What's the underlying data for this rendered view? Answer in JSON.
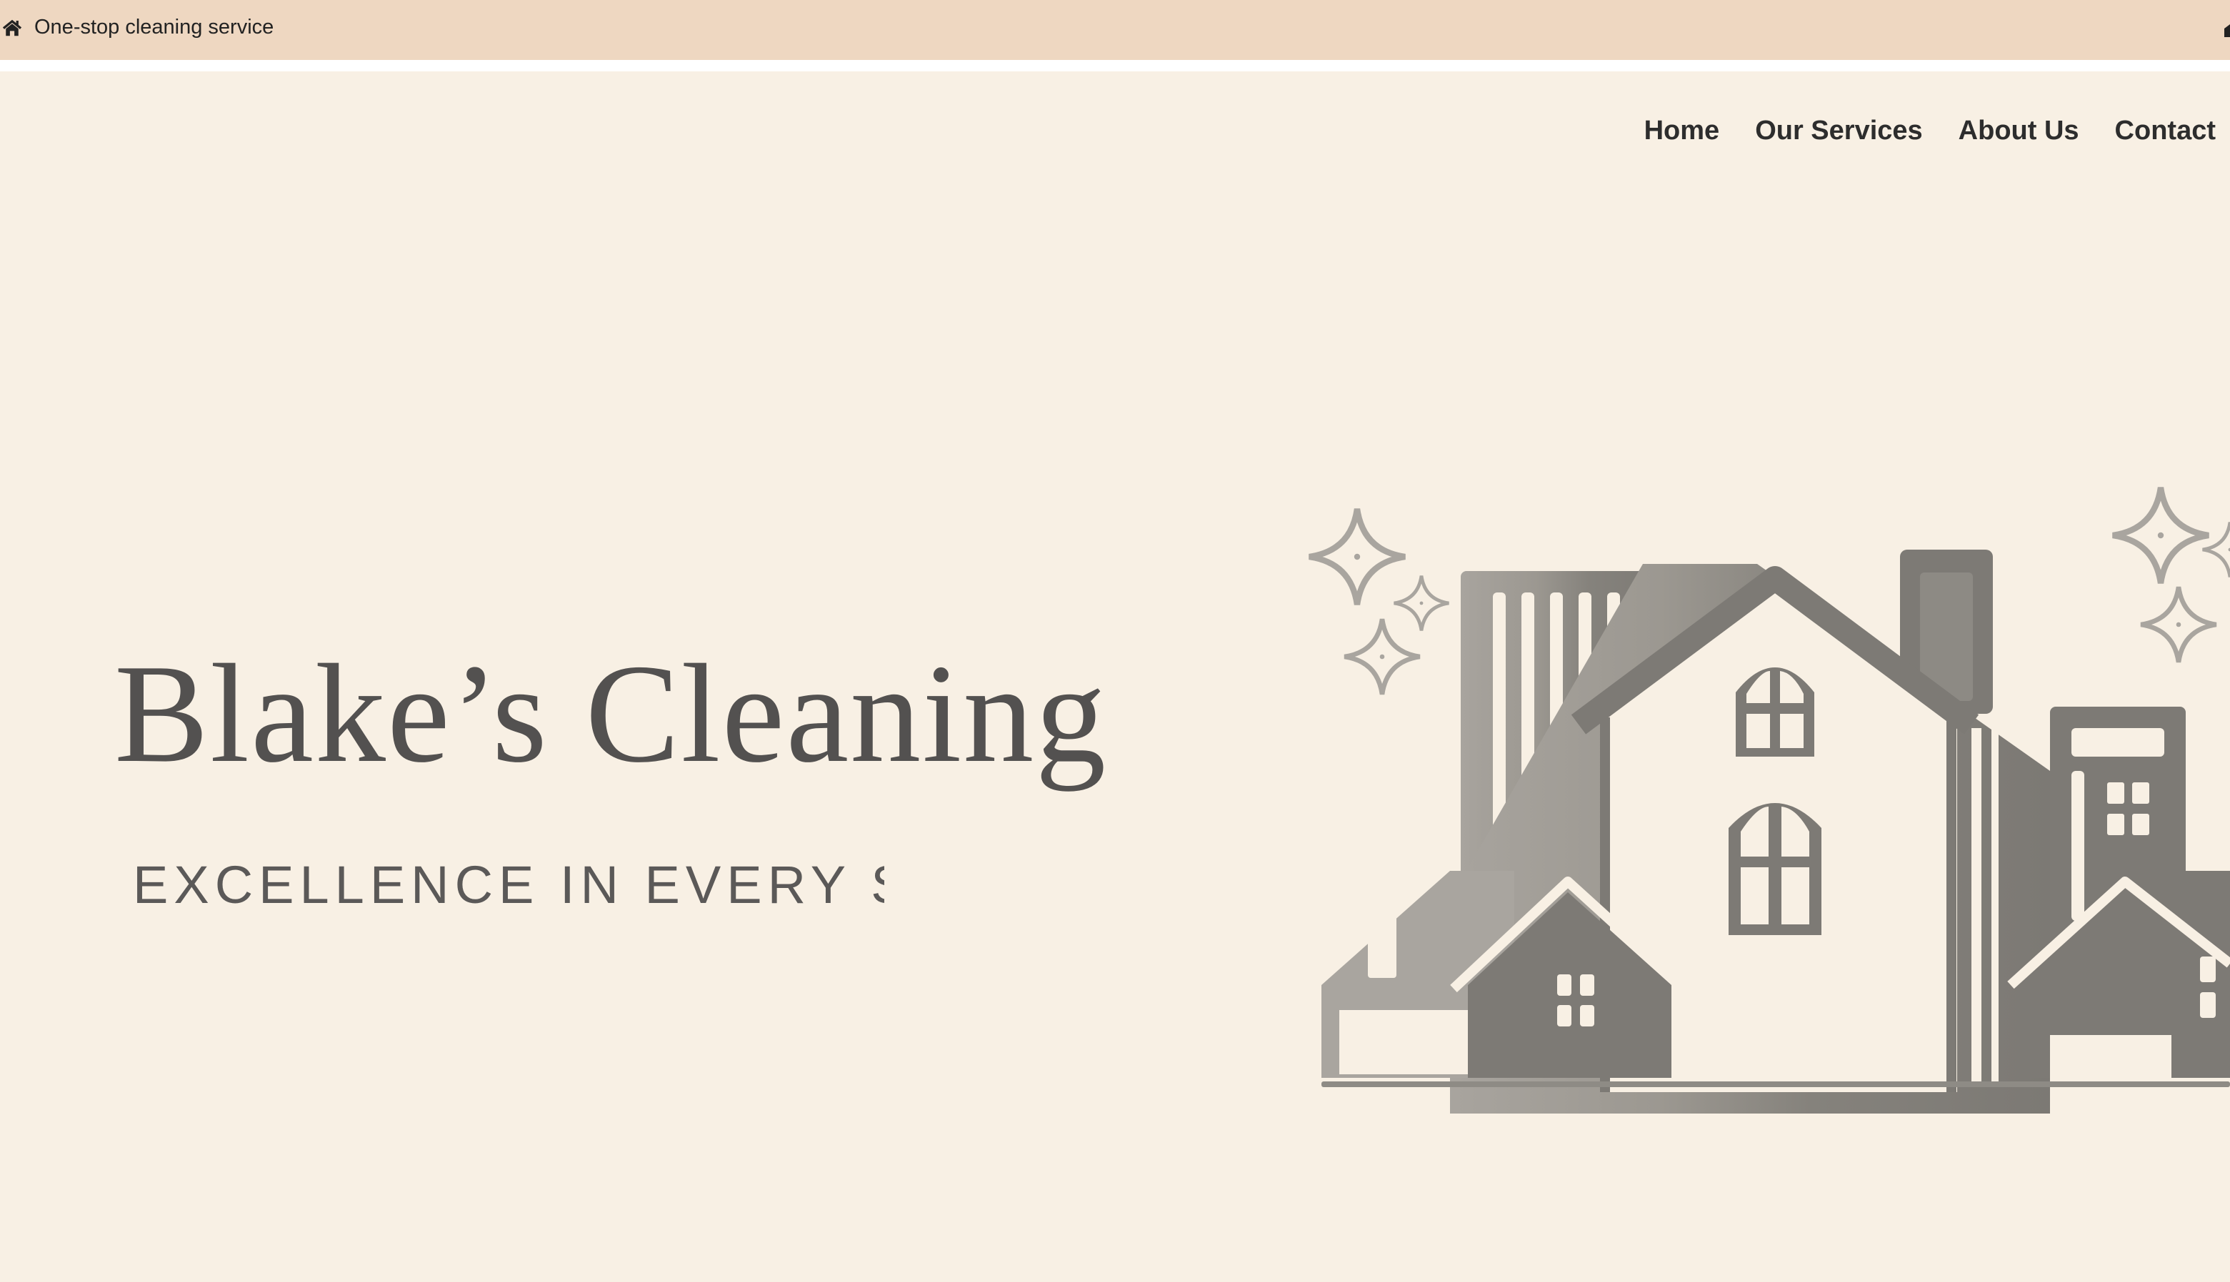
{
  "topbar": {
    "icon": "home-icon",
    "tagline": "One-stop cleaning service"
  },
  "nav": {
    "items": [
      {
        "label": "Home"
      },
      {
        "label": "Our Services"
      },
      {
        "label": "About Us"
      },
      {
        "label": "Contact"
      }
    ]
  },
  "hero": {
    "title": "Blake’s Cleaning",
    "subtitle": "EXCELLENCE IN EVERY SWE",
    "illustration": "houses-illustration"
  },
  "colors": {
    "topbar_bg": "#eed7c1",
    "hero_bg": "#f8f0e4",
    "logo_text": "#535150",
    "nav_text": "#2d2d2d"
  }
}
